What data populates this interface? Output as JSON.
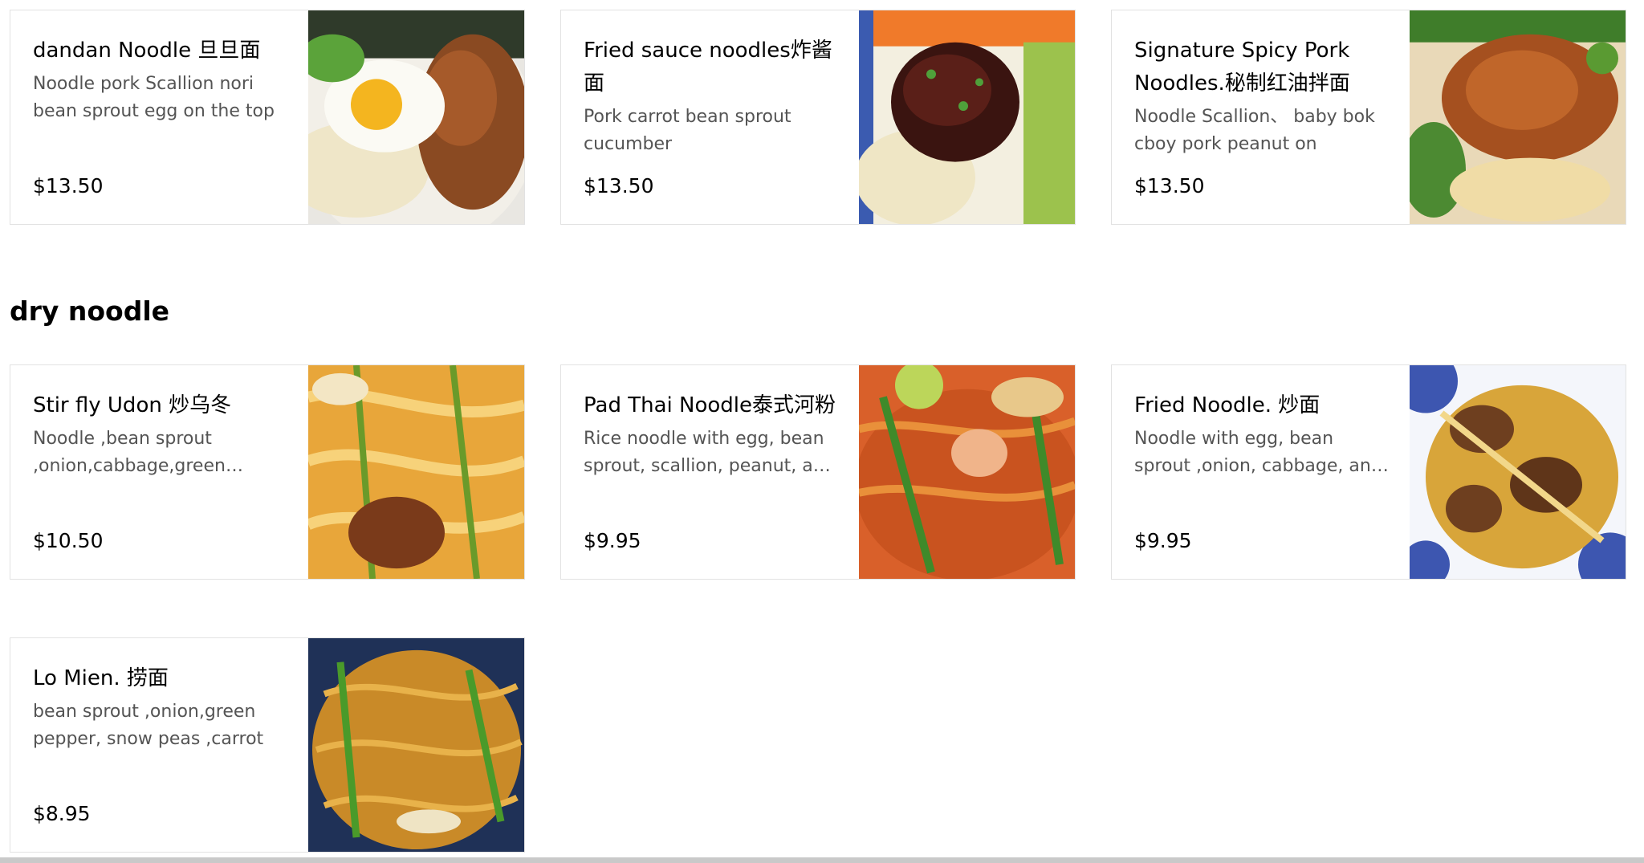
{
  "top_items": [
    {
      "title": "dandan Noodle 旦旦面",
      "desc": "Noodle pork Scallion nori bean sprout egg on the top",
      "price": "$13.50"
    },
    {
      "title": "Fried sauce noodles炸酱面",
      "desc": "Pork carrot bean sprout cucumber",
      "price": "$13.50"
    },
    {
      "title": "Signature Spicy Pork Noodles.秘制红油拌面",
      "desc": "Noodle Scallion、 baby bok cboy pork peanut on",
      "price": "$13.50"
    }
  ],
  "section": {
    "heading": "dry noodle"
  },
  "dry_items": [
    {
      "title": "Stir fly Udon 炒乌冬",
      "desc": "Noodle ,bean sprout ,onion,cabbage,green pepper",
      "price": "$10.50"
    },
    {
      "title": "Pad Thai Noodle泰式河粉",
      "desc": "Rice noodle with egg, bean sprout, scallion, peanut, and lime",
      "price": "$9.95"
    },
    {
      "title": "Fried Noodle. 炒面",
      "desc": "Noodle with egg, bean sprout ,onion, cabbage, and carrot",
      "price": "$9.95"
    },
    {
      "title": "Lo Mien. 捞面",
      "desc": "bean sprout ,onion,green pepper, snow peas ,carrot",
      "price": "$8.95"
    }
  ],
  "icons": {
    "photo_1": "dandan-noodle-photo",
    "photo_2": "fried-sauce-noodle-photo",
    "photo_3": "spicy-pork-noodle-photo",
    "photo_4": "udon-photo",
    "photo_5": "pad-thai-photo",
    "photo_6": "fried-noodle-photo",
    "photo_7": "lo-mien-photo"
  },
  "colors": {
    "border": "#e2e2e2",
    "text": "#000000",
    "muted": "#545454"
  }
}
